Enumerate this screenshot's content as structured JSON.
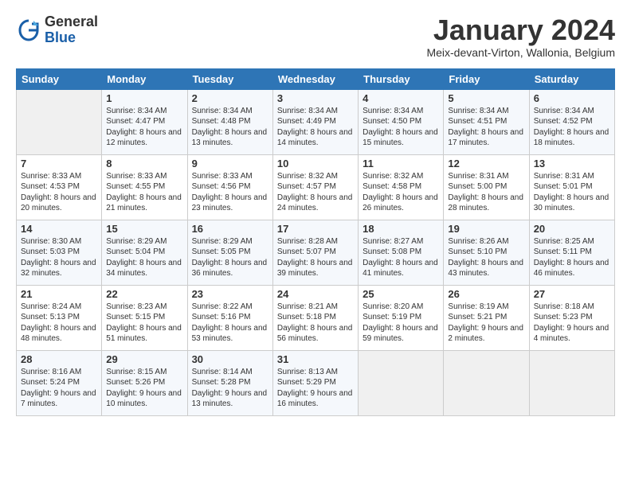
{
  "header": {
    "logo_general": "General",
    "logo_blue": "Blue",
    "month_title": "January 2024",
    "location": "Meix-devant-Virton, Wallonia, Belgium"
  },
  "weekdays": [
    "Sunday",
    "Monday",
    "Tuesday",
    "Wednesday",
    "Thursday",
    "Friday",
    "Saturday"
  ],
  "weeks": [
    [
      {
        "day": "",
        "sunrise": "",
        "sunset": "",
        "daylight": ""
      },
      {
        "day": "1",
        "sunrise": "Sunrise: 8:34 AM",
        "sunset": "Sunset: 4:47 PM",
        "daylight": "Daylight: 8 hours and 12 minutes."
      },
      {
        "day": "2",
        "sunrise": "Sunrise: 8:34 AM",
        "sunset": "Sunset: 4:48 PM",
        "daylight": "Daylight: 8 hours and 13 minutes."
      },
      {
        "day": "3",
        "sunrise": "Sunrise: 8:34 AM",
        "sunset": "Sunset: 4:49 PM",
        "daylight": "Daylight: 8 hours and 14 minutes."
      },
      {
        "day": "4",
        "sunrise": "Sunrise: 8:34 AM",
        "sunset": "Sunset: 4:50 PM",
        "daylight": "Daylight: 8 hours and 15 minutes."
      },
      {
        "day": "5",
        "sunrise": "Sunrise: 8:34 AM",
        "sunset": "Sunset: 4:51 PM",
        "daylight": "Daylight: 8 hours and 17 minutes."
      },
      {
        "day": "6",
        "sunrise": "Sunrise: 8:34 AM",
        "sunset": "Sunset: 4:52 PM",
        "daylight": "Daylight: 8 hours and 18 minutes."
      }
    ],
    [
      {
        "day": "7",
        "sunrise": "Sunrise: 8:33 AM",
        "sunset": "Sunset: 4:53 PM",
        "daylight": "Daylight: 8 hours and 20 minutes."
      },
      {
        "day": "8",
        "sunrise": "Sunrise: 8:33 AM",
        "sunset": "Sunset: 4:55 PM",
        "daylight": "Daylight: 8 hours and 21 minutes."
      },
      {
        "day": "9",
        "sunrise": "Sunrise: 8:33 AM",
        "sunset": "Sunset: 4:56 PM",
        "daylight": "Daylight: 8 hours and 23 minutes."
      },
      {
        "day": "10",
        "sunrise": "Sunrise: 8:32 AM",
        "sunset": "Sunset: 4:57 PM",
        "daylight": "Daylight: 8 hours and 24 minutes."
      },
      {
        "day": "11",
        "sunrise": "Sunrise: 8:32 AM",
        "sunset": "Sunset: 4:58 PM",
        "daylight": "Daylight: 8 hours and 26 minutes."
      },
      {
        "day": "12",
        "sunrise": "Sunrise: 8:31 AM",
        "sunset": "Sunset: 5:00 PM",
        "daylight": "Daylight: 8 hours and 28 minutes."
      },
      {
        "day": "13",
        "sunrise": "Sunrise: 8:31 AM",
        "sunset": "Sunset: 5:01 PM",
        "daylight": "Daylight: 8 hours and 30 minutes."
      }
    ],
    [
      {
        "day": "14",
        "sunrise": "Sunrise: 8:30 AM",
        "sunset": "Sunset: 5:03 PM",
        "daylight": "Daylight: 8 hours and 32 minutes."
      },
      {
        "day": "15",
        "sunrise": "Sunrise: 8:29 AM",
        "sunset": "Sunset: 5:04 PM",
        "daylight": "Daylight: 8 hours and 34 minutes."
      },
      {
        "day": "16",
        "sunrise": "Sunrise: 8:29 AM",
        "sunset": "Sunset: 5:05 PM",
        "daylight": "Daylight: 8 hours and 36 minutes."
      },
      {
        "day": "17",
        "sunrise": "Sunrise: 8:28 AM",
        "sunset": "Sunset: 5:07 PM",
        "daylight": "Daylight: 8 hours and 39 minutes."
      },
      {
        "day": "18",
        "sunrise": "Sunrise: 8:27 AM",
        "sunset": "Sunset: 5:08 PM",
        "daylight": "Daylight: 8 hours and 41 minutes."
      },
      {
        "day": "19",
        "sunrise": "Sunrise: 8:26 AM",
        "sunset": "Sunset: 5:10 PM",
        "daylight": "Daylight: 8 hours and 43 minutes."
      },
      {
        "day": "20",
        "sunrise": "Sunrise: 8:25 AM",
        "sunset": "Sunset: 5:11 PM",
        "daylight": "Daylight: 8 hours and 46 minutes."
      }
    ],
    [
      {
        "day": "21",
        "sunrise": "Sunrise: 8:24 AM",
        "sunset": "Sunset: 5:13 PM",
        "daylight": "Daylight: 8 hours and 48 minutes."
      },
      {
        "day": "22",
        "sunrise": "Sunrise: 8:23 AM",
        "sunset": "Sunset: 5:15 PM",
        "daylight": "Daylight: 8 hours and 51 minutes."
      },
      {
        "day": "23",
        "sunrise": "Sunrise: 8:22 AM",
        "sunset": "Sunset: 5:16 PM",
        "daylight": "Daylight: 8 hours and 53 minutes."
      },
      {
        "day": "24",
        "sunrise": "Sunrise: 8:21 AM",
        "sunset": "Sunset: 5:18 PM",
        "daylight": "Daylight: 8 hours and 56 minutes."
      },
      {
        "day": "25",
        "sunrise": "Sunrise: 8:20 AM",
        "sunset": "Sunset: 5:19 PM",
        "daylight": "Daylight: 8 hours and 59 minutes."
      },
      {
        "day": "26",
        "sunrise": "Sunrise: 8:19 AM",
        "sunset": "Sunset: 5:21 PM",
        "daylight": "Daylight: 9 hours and 2 minutes."
      },
      {
        "day": "27",
        "sunrise": "Sunrise: 8:18 AM",
        "sunset": "Sunset: 5:23 PM",
        "daylight": "Daylight: 9 hours and 4 minutes."
      }
    ],
    [
      {
        "day": "28",
        "sunrise": "Sunrise: 8:16 AM",
        "sunset": "Sunset: 5:24 PM",
        "daylight": "Daylight: 9 hours and 7 minutes."
      },
      {
        "day": "29",
        "sunrise": "Sunrise: 8:15 AM",
        "sunset": "Sunset: 5:26 PM",
        "daylight": "Daylight: 9 hours and 10 minutes."
      },
      {
        "day": "30",
        "sunrise": "Sunrise: 8:14 AM",
        "sunset": "Sunset: 5:28 PM",
        "daylight": "Daylight: 9 hours and 13 minutes."
      },
      {
        "day": "31",
        "sunrise": "Sunrise: 8:13 AM",
        "sunset": "Sunset: 5:29 PM",
        "daylight": "Daylight: 9 hours and 16 minutes."
      },
      {
        "day": "",
        "sunrise": "",
        "sunset": "",
        "daylight": ""
      },
      {
        "day": "",
        "sunrise": "",
        "sunset": "",
        "daylight": ""
      },
      {
        "day": "",
        "sunrise": "",
        "sunset": "",
        "daylight": ""
      }
    ]
  ]
}
